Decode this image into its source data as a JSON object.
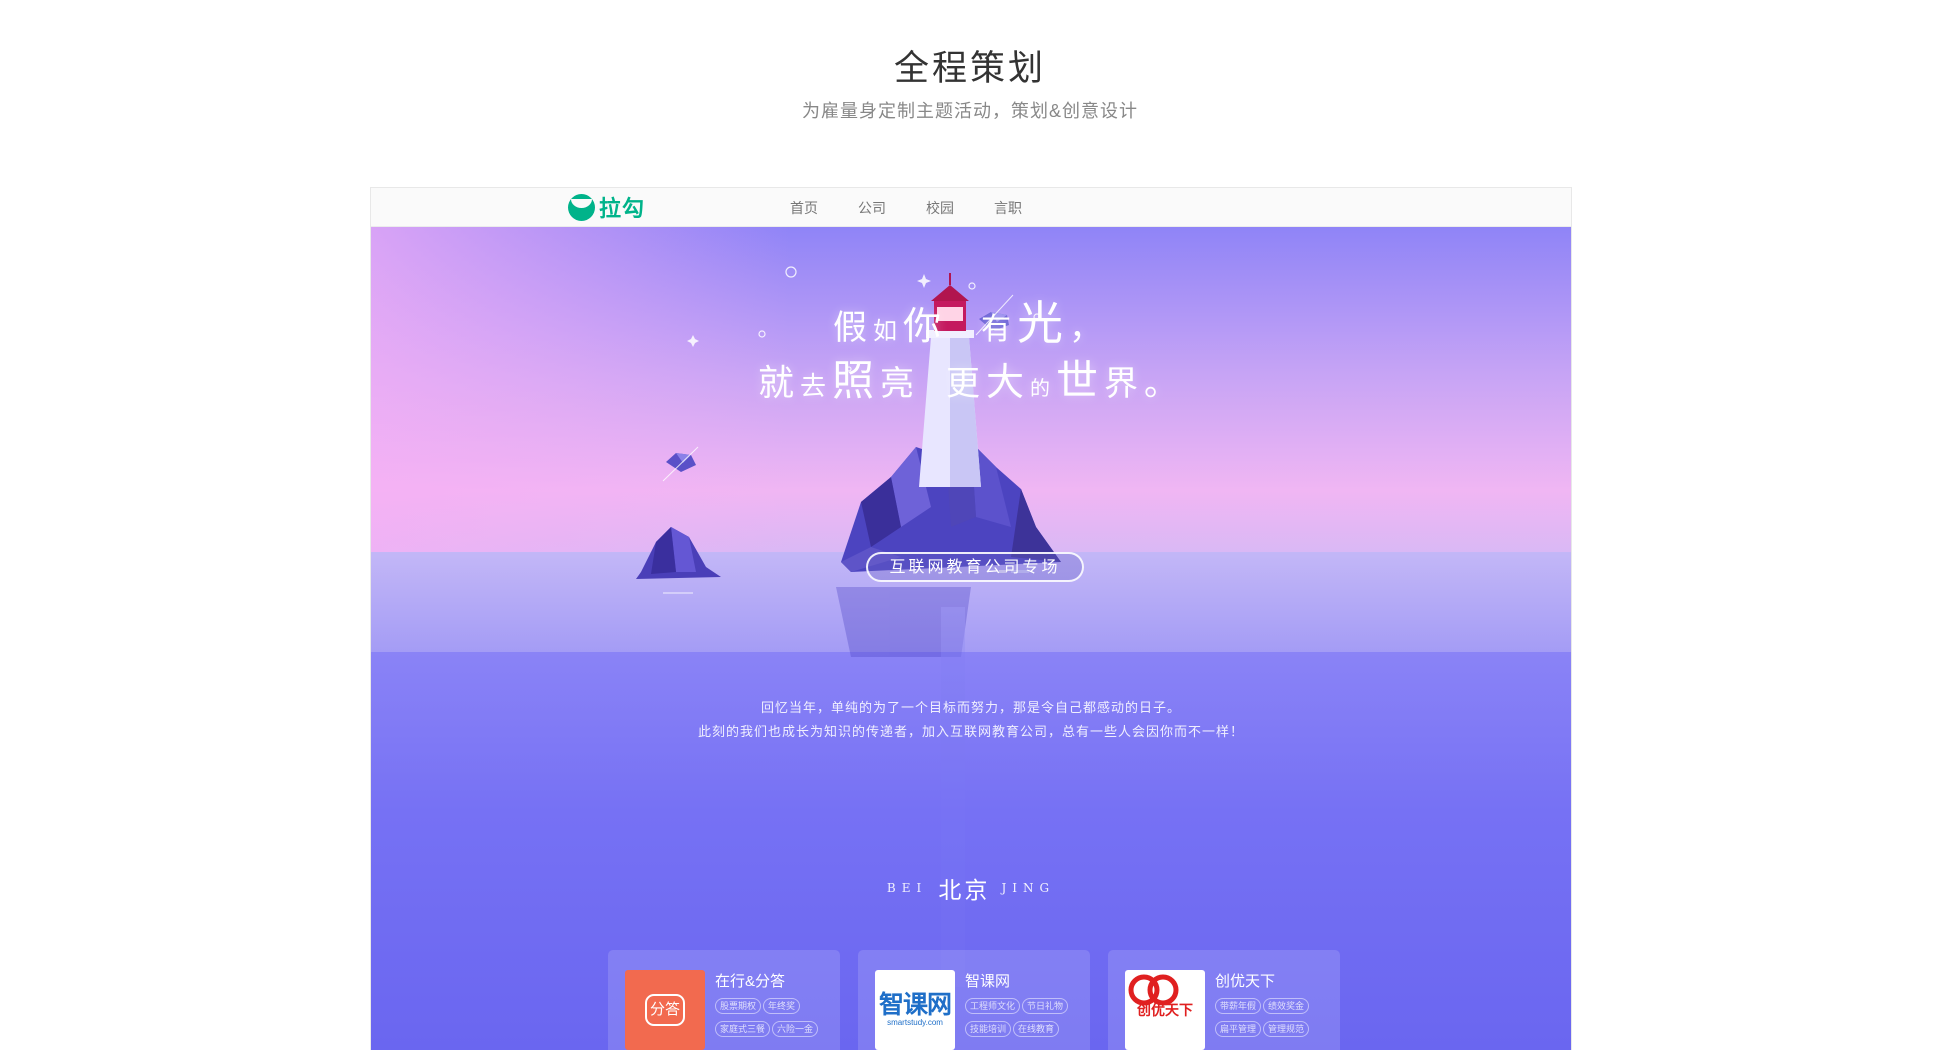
{
  "section": {
    "title": "全程策划",
    "subtitle": "为雇量身定制主题活动，策划&创意设计"
  },
  "navbar": {
    "logo_text": "拉勾",
    "links": [
      "首页",
      "公司",
      "校园",
      "言职"
    ]
  },
  "hero": {
    "poem_line1": [
      "假",
      "如",
      "你",
      "有",
      "光",
      "，"
    ],
    "poem_line2": [
      "就",
      "去",
      "照",
      "亮",
      "更",
      "大",
      "的",
      "世",
      "界",
      "。"
    ],
    "pill_label": "互联网教育公司专场",
    "intro_lines": [
      "回忆当年，单纯的为了一个目标而努力，那是令自己都感动的日子。",
      "此刻的我们也成长为知识的传递者，加入互联网教育公司，总有一些人会因你而不一样！"
    ],
    "city_left": "BEI",
    "city_cn": "北京",
    "city_right": "JING"
  },
  "cards": [
    {
      "name": "在行&分答",
      "logo_text": "分答",
      "logo_color": "#f26a4f",
      "tags": [
        "股票期权",
        "年终奖",
        "家庭式三餐",
        "六险一金"
      ]
    },
    {
      "name": "智课网",
      "logo_text": "智课网",
      "logo_sub": "smartstudy.com",
      "logo_color": "#1f6fc8",
      "tags": [
        "工程师文化",
        "节日礼物",
        "技能培训",
        "在线教育"
      ]
    },
    {
      "name": "创优天下",
      "logo_text": "创优天下",
      "logo_color": "#e02020",
      "tags": [
        "带薪年假",
        "绩效奖金",
        "扁平管理",
        "管理规范"
      ]
    }
  ],
  "colors": {
    "brand_green": "#00b38a",
    "hero_purple": "#6e6af4",
    "sky_pink": "#f2b9f2"
  }
}
